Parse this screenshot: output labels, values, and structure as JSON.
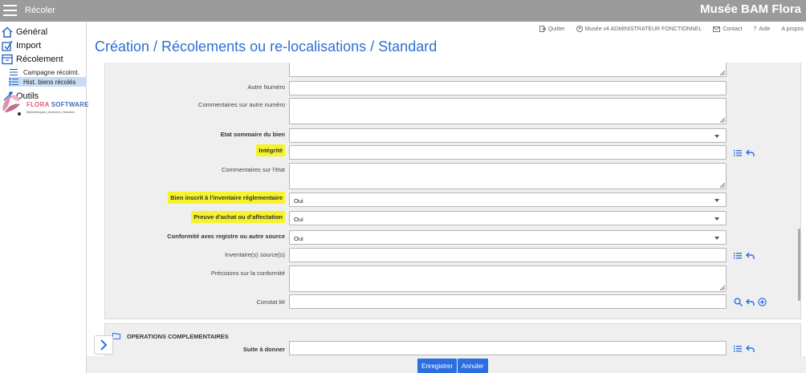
{
  "topbar": {
    "app_title": "Récoler",
    "brand_title": "Musée BAM Flora"
  },
  "sidebar": {
    "items": [
      {
        "label": "Général",
        "icon": "home-icon"
      },
      {
        "label": "Import",
        "icon": "import-icon"
      },
      {
        "label": "Récolement",
        "icon": "archive-icon"
      }
    ],
    "subitems": [
      {
        "label": "Campagne récolmt.",
        "icon": "list-icon"
      },
      {
        "label": "Hist. biens récolés",
        "icon": "checklist-icon",
        "active": true
      }
    ],
    "tools": {
      "label": "Outils",
      "icon": "wrench-icon"
    },
    "logo": {
      "text_a": "FLORA",
      "text_b": " SOFTWARE",
      "sub": "Bibliothèques | Archives | Musées"
    }
  },
  "toplinks": {
    "quit": "Quitter",
    "user": "Musée v4 ADMINISTRATEUR FONCTIONNEL",
    "contact": "Contact",
    "help": "Aide",
    "about": "A propos"
  },
  "page_title": "Création / Récolements ou re-localisations / Standard",
  "form": {
    "autre_numero": {
      "label": "Autre Numéro",
      "value": ""
    },
    "commentaires_autre_numero": {
      "label": "Commentaires sur autre numéro",
      "value": ""
    },
    "etat_sommaire": {
      "label": "Etat sommaire du bien",
      "value": ""
    },
    "integrite": {
      "label": "Intégrité",
      "value": ""
    },
    "commentaires_etat": {
      "label": "Commentaires sur l'état",
      "value": ""
    },
    "bien_inscrit": {
      "label": "Bien inscrit à l'inventaire réglementaire",
      "value": "Oui"
    },
    "preuve_achat": {
      "label": "Preuve d'achat ou d'affectation",
      "value": "Oui"
    },
    "conformite": {
      "label": "Conformité avec registre ou autre source",
      "value": "Oui"
    },
    "inventaires_sources": {
      "label": "Inventaire(s) source(s)",
      "value": ""
    },
    "precisions_conformite": {
      "label": "Précisions sur la conformité",
      "value": ""
    },
    "constat_lie": {
      "label": "Constat lié",
      "value": ""
    }
  },
  "section2": {
    "title": "OPERATIONS COMPLEMENTAIRES",
    "suite_a_donner": {
      "label": "Suite à donner",
      "value": ""
    }
  },
  "buttons": {
    "save": "Enregistrer",
    "cancel": "Annuler"
  },
  "colors": {
    "accent": "#2a6ee0",
    "title": "#2d6fd0",
    "highlight": "#f6f32c",
    "topbar": "#9b9b9b"
  }
}
